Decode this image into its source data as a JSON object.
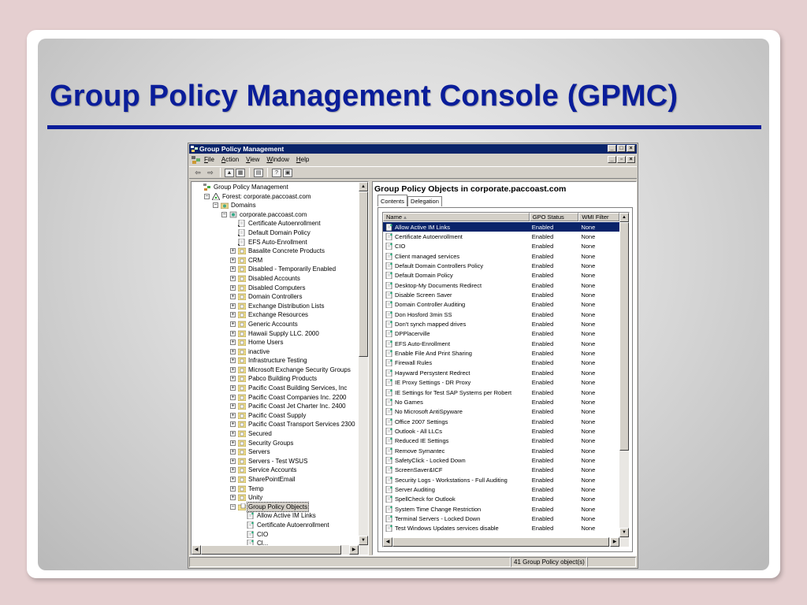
{
  "slide": {
    "title": "Group Policy Management Console (GPMC)"
  },
  "window": {
    "title": "Group Policy Management",
    "menu": [
      "File",
      "Action",
      "View",
      "Window",
      "Help"
    ]
  },
  "tree": {
    "items": [
      {
        "label": "Group Policy Management",
        "level": 0,
        "toggle": "",
        "icon": "gpm-root-icon"
      },
      {
        "label": "Forest: corporate.paccoast.com",
        "level": 1,
        "toggle": "-",
        "icon": "forest-icon"
      },
      {
        "label": "Domains",
        "level": 2,
        "toggle": "-",
        "icon": "domains-folder-icon"
      },
      {
        "label": "corporate.paccoast.com",
        "level": 3,
        "toggle": "-",
        "icon": "domain-icon"
      },
      {
        "label": "Certificate Autoenrollment",
        "level": 4,
        "toggle": "",
        "icon": "gpo-link-icon"
      },
      {
        "label": "Default Domain Policy",
        "level": 4,
        "toggle": "",
        "icon": "gpo-link-icon"
      },
      {
        "label": "EFS Auto-Enrollment",
        "level": 4,
        "toggle": "",
        "icon": "gpo-link-icon"
      },
      {
        "label": "Basalite Concrete Products",
        "level": 4,
        "toggle": "+",
        "icon": "ou-icon"
      },
      {
        "label": "CRM",
        "level": 4,
        "toggle": "+",
        "icon": "ou-icon"
      },
      {
        "label": "Disabled - Temporarily Enabled",
        "level": 4,
        "toggle": "+",
        "icon": "ou-icon"
      },
      {
        "label": "Disabled Accounts",
        "level": 4,
        "toggle": "+",
        "icon": "ou-icon"
      },
      {
        "label": "Disabled Computers",
        "level": 4,
        "toggle": "+",
        "icon": "ou-icon"
      },
      {
        "label": "Domain Controllers",
        "level": 4,
        "toggle": "+",
        "icon": "ou-icon"
      },
      {
        "label": "Exchange Distribution Lists",
        "level": 4,
        "toggle": "+",
        "icon": "ou-icon"
      },
      {
        "label": "Exchange Resources",
        "level": 4,
        "toggle": "+",
        "icon": "ou-icon"
      },
      {
        "label": "Generic Accounts",
        "level": 4,
        "toggle": "+",
        "icon": "ou-icon"
      },
      {
        "label": "Hawaii Supply LLC. 2000",
        "level": 4,
        "toggle": "+",
        "icon": "ou-icon"
      },
      {
        "label": "Home Users",
        "level": 4,
        "toggle": "+",
        "icon": "ou-icon"
      },
      {
        "label": "inactive",
        "level": 4,
        "toggle": "+",
        "icon": "ou-icon"
      },
      {
        "label": "Infrastructure Testing",
        "level": 4,
        "toggle": "+",
        "icon": "ou-icon"
      },
      {
        "label": "Microsoft Exchange Security Groups",
        "level": 4,
        "toggle": "+",
        "icon": "ou-icon"
      },
      {
        "label": "Pabco Building Products",
        "level": 4,
        "toggle": "+",
        "icon": "ou-icon"
      },
      {
        "label": "Pacific Coast Building Services, Inc",
        "level": 4,
        "toggle": "+",
        "icon": "ou-icon"
      },
      {
        "label": "Pacific Coast Companies Inc. 2200",
        "level": 4,
        "toggle": "+",
        "icon": "ou-icon"
      },
      {
        "label": "Pacific Coast Jet Charter Inc. 2400",
        "level": 4,
        "toggle": "+",
        "icon": "ou-icon"
      },
      {
        "label": "Pacific Coast Supply",
        "level": 4,
        "toggle": "+",
        "icon": "ou-icon"
      },
      {
        "label": "Pacific Coast Transport Services 2300",
        "level": 4,
        "toggle": "+",
        "icon": "ou-icon"
      },
      {
        "label": "Secured",
        "level": 4,
        "toggle": "+",
        "icon": "ou-icon"
      },
      {
        "label": "Security Groups",
        "level": 4,
        "toggle": "+",
        "icon": "ou-icon"
      },
      {
        "label": "Servers",
        "level": 4,
        "toggle": "+",
        "icon": "ou-icon"
      },
      {
        "label": "Servers - Test WSUS",
        "level": 4,
        "toggle": "+",
        "icon": "ou-icon"
      },
      {
        "label": "Service Accounts",
        "level": 4,
        "toggle": "+",
        "icon": "ou-icon"
      },
      {
        "label": "SharePointEmail",
        "level": 4,
        "toggle": "+",
        "icon": "ou-icon"
      },
      {
        "label": "Temp",
        "level": 4,
        "toggle": "+",
        "icon": "ou-icon"
      },
      {
        "label": "Unity",
        "level": 4,
        "toggle": "+",
        "icon": "ou-icon"
      },
      {
        "label": "Group Policy Objects",
        "level": 4,
        "toggle": "-",
        "icon": "gpo-folder-icon",
        "selected": true
      },
      {
        "label": "Allow Active IM Links",
        "level": 5,
        "toggle": "",
        "icon": "gpo-icon"
      },
      {
        "label": "Certificate Autoenrollment",
        "level": 5,
        "toggle": "",
        "icon": "gpo-icon"
      },
      {
        "label": "CIO",
        "level": 5,
        "toggle": "",
        "icon": "gpo-icon"
      },
      {
        "label": "Cl...",
        "level": 5,
        "toggle": "",
        "icon": "gpo-icon"
      }
    ]
  },
  "right_pane": {
    "title": "Group Policy Objects in corporate.paccoast.com",
    "tabs": [
      "Contents",
      "Delegation"
    ],
    "columns": [
      "Name",
      "GPO Status",
      "WMI Filter"
    ],
    "rows": [
      [
        "Allow Active IM Links",
        "Enabled",
        "None"
      ],
      [
        "Certificate Autoenrollment",
        "Enabled",
        "None"
      ],
      [
        "CIO",
        "Enabled",
        "None"
      ],
      [
        "Client managed services",
        "Enabled",
        "None"
      ],
      [
        "Default Domain Controllers Policy",
        "Enabled",
        "None"
      ],
      [
        "Default Domain Policy",
        "Enabled",
        "None"
      ],
      [
        "Desktop-My Documents Redirect",
        "Enabled",
        "None"
      ],
      [
        "Disable Screen Saver",
        "Enabled",
        "None"
      ],
      [
        "Domain Controller Auditing",
        "Enabled",
        "None"
      ],
      [
        "Don Hosford 3min SS",
        "Enabled",
        "None"
      ],
      [
        "Don't synch mapped drives",
        "Enabled",
        "None"
      ],
      [
        "DPPlacerville",
        "Enabled",
        "None"
      ],
      [
        "EFS Auto-Enrollment",
        "Enabled",
        "None"
      ],
      [
        "Enable File And Print Sharing",
        "Enabled",
        "None"
      ],
      [
        "Firewall Rules",
        "Enabled",
        "None"
      ],
      [
        "Hayward Persystent Redrect",
        "Enabled",
        "None"
      ],
      [
        "IE Proxy Settings - DR Proxy",
        "Enabled",
        "None"
      ],
      [
        "IE Settings for Test SAP Systems per Robert",
        "Enabled",
        "None"
      ],
      [
        "No Games",
        "Enabled",
        "None"
      ],
      [
        "No Microsoft AntiSpyware",
        "Enabled",
        "None"
      ],
      [
        "Office 2007 Settings",
        "Enabled",
        "None"
      ],
      [
        "Outlook - All LLCs",
        "Enabled",
        "None"
      ],
      [
        "Reduced IE Settings",
        "Enabled",
        "None"
      ],
      [
        "Remove Symantec",
        "Enabled",
        "None"
      ],
      [
        "SafetyClick - Locked Down",
        "Enabled",
        "None"
      ],
      [
        "ScreenSaver&ICF",
        "Enabled",
        "None"
      ],
      [
        "Security Logs - Workstations - Full Auditing",
        "Enabled",
        "None"
      ],
      [
        "Server Auditing",
        "Enabled",
        "None"
      ],
      [
        "SpellCheck for Outlook",
        "Enabled",
        "None"
      ],
      [
        "System Time Change Restriction",
        "Enabled",
        "None"
      ],
      [
        "Terminal Servers - Locked Down",
        "Enabled",
        "None"
      ],
      [
        "Test Windows Updates services disable",
        "Enabled",
        "None"
      ]
    ]
  },
  "status_bar": {
    "count_text": "41 Group Policy object(s)"
  },
  "colors": {
    "title_blue": "#0a1d9a",
    "window_titlebar": "#0a246a",
    "selection": "#0a246a"
  }
}
